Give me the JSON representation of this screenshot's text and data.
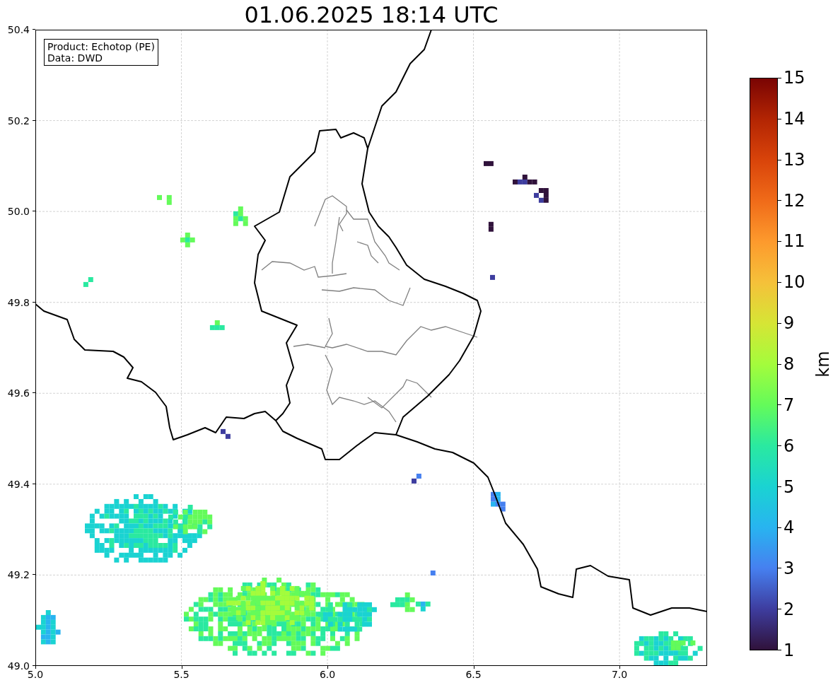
{
  "title": "01.06.2025 18:14 UTC",
  "legend": [
    "Product: Echotop (PE)",
    "Data: DWD"
  ],
  "map": {
    "xticks": [
      "5.0",
      "5.5",
      "6.0",
      "6.5",
      "7.0"
    ],
    "yticks": [
      "50.4",
      "50.2",
      "50.0",
      "49.8",
      "49.6",
      "49.4",
      "49.2",
      "49.0"
    ]
  },
  "colorbar": {
    "label": "km",
    "ticks": [
      "15",
      "14",
      "13",
      "12",
      "11",
      "10",
      "9",
      "8",
      "7",
      "6",
      "5",
      "4",
      "3",
      "2",
      "1"
    ]
  }
}
